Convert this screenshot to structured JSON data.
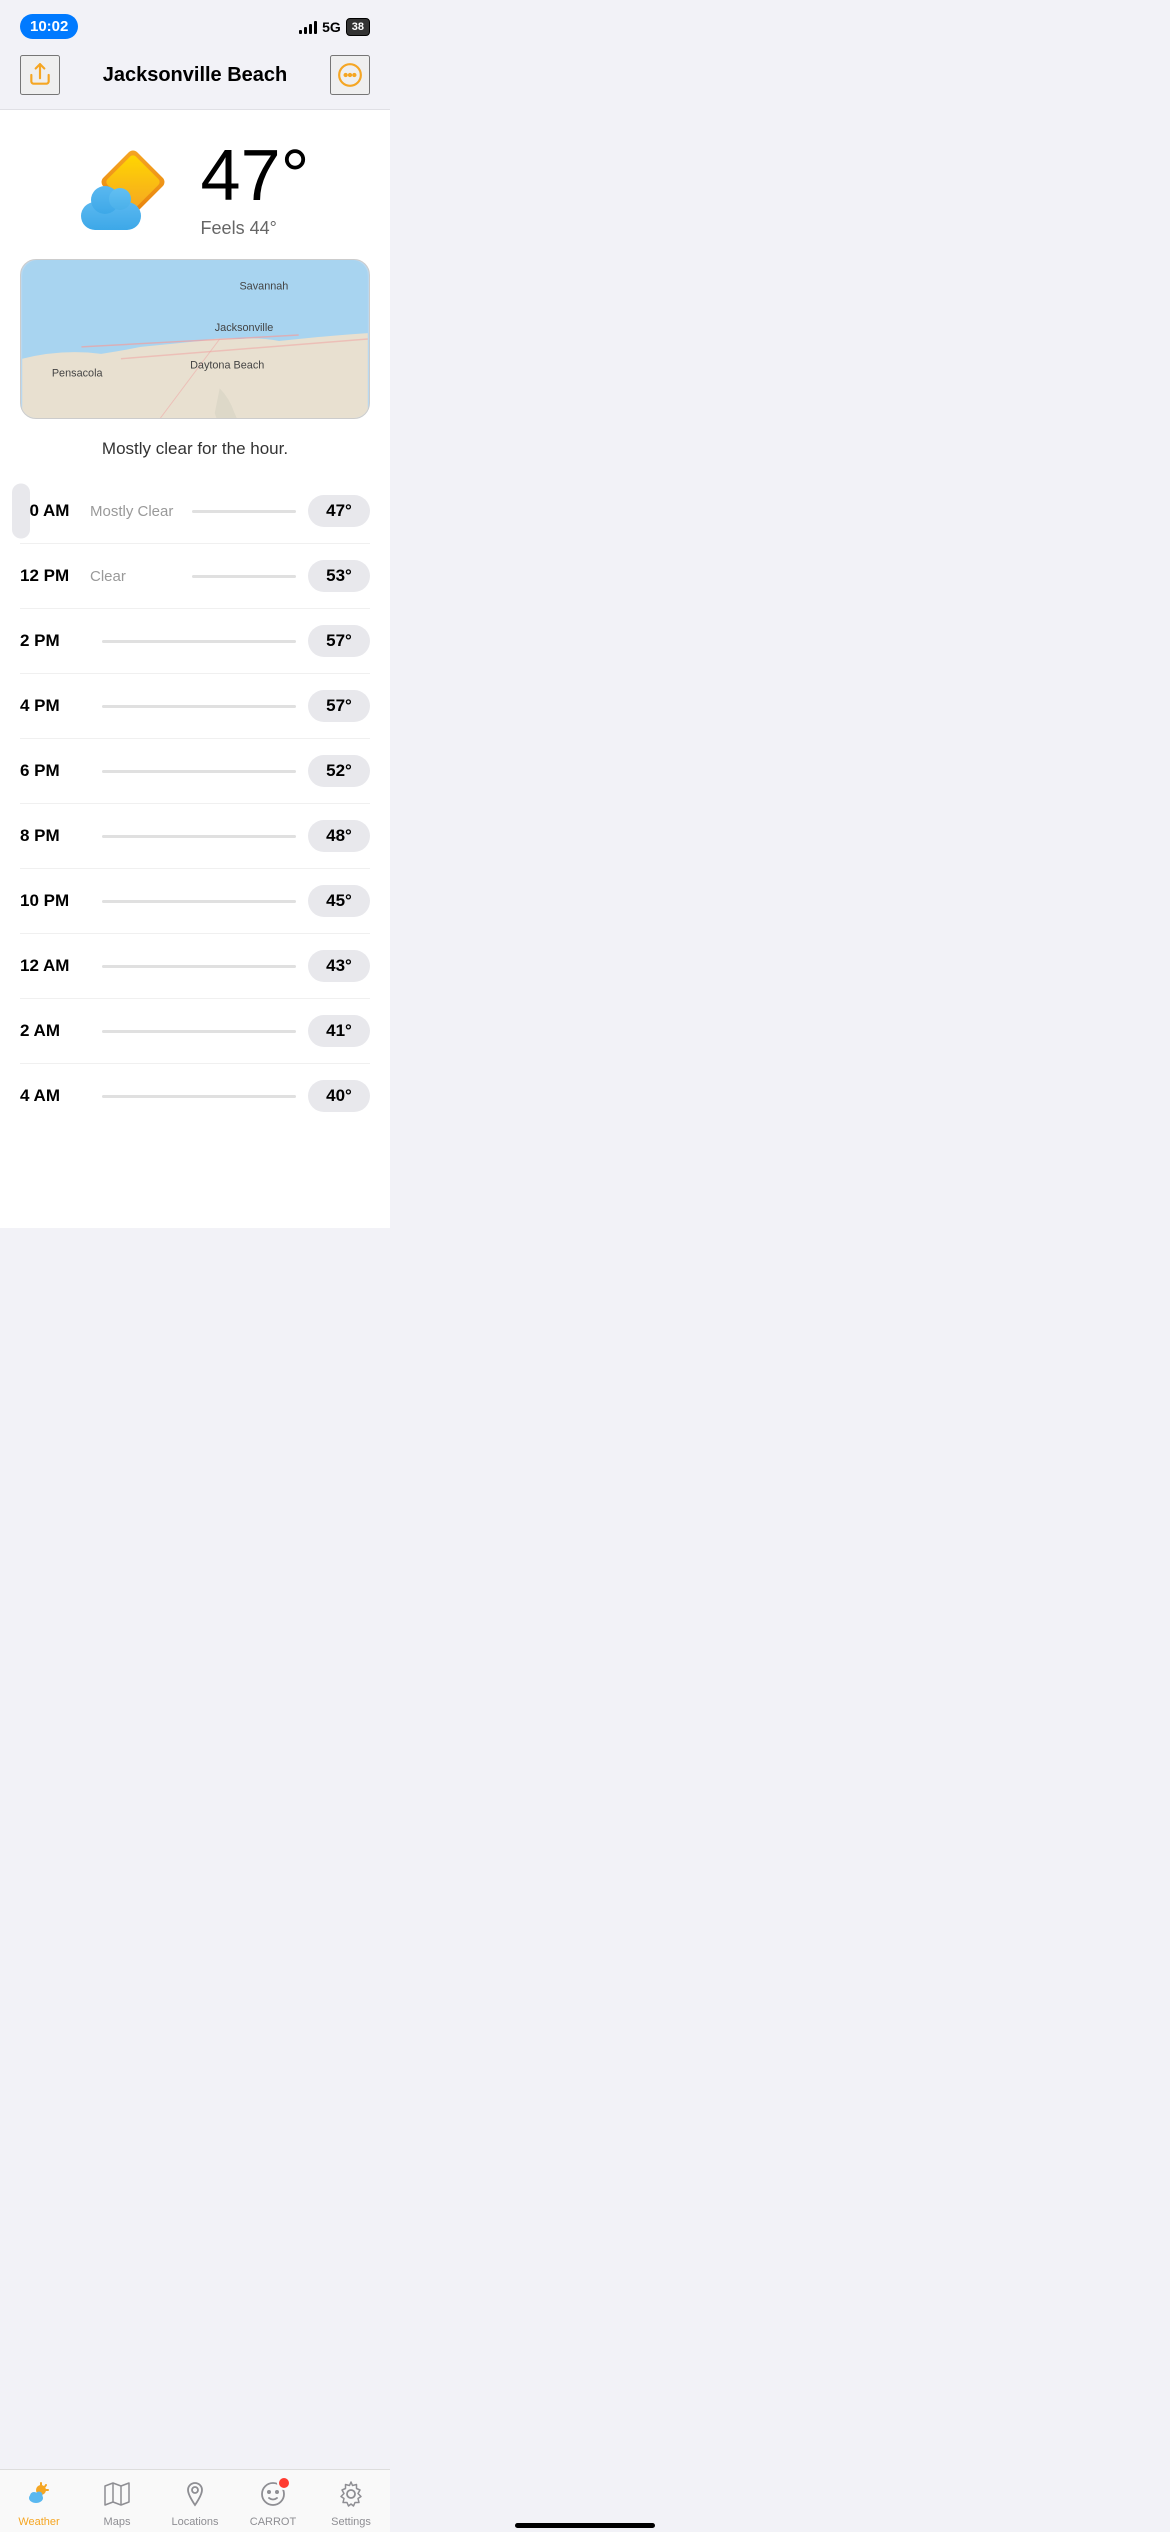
{
  "statusBar": {
    "time": "10:02",
    "network": "5G",
    "battery": "38"
  },
  "header": {
    "title": "Jacksonville Beach",
    "shareLabel": "share",
    "moreLabel": "more"
  },
  "weather": {
    "temperature": "47°",
    "feelsLike": "Feels 44°",
    "summary": "Mostly clear for the hour."
  },
  "hourlyForecast": [
    {
      "time": "10 AM",
      "condition": "Mostly Clear",
      "temp": "47°",
      "isCurrent": true
    },
    {
      "time": "12 PM",
      "condition": "Clear",
      "temp": "53°",
      "isCurrent": false
    },
    {
      "time": "2 PM",
      "condition": "",
      "temp": "57°",
      "isCurrent": false
    },
    {
      "time": "4 PM",
      "condition": "",
      "temp": "57°",
      "isCurrent": false
    },
    {
      "time": "6 PM",
      "condition": "",
      "temp": "52°",
      "isCurrent": false
    },
    {
      "time": "8 PM",
      "condition": "",
      "temp": "48°",
      "isCurrent": false
    },
    {
      "time": "10 PM",
      "condition": "",
      "temp": "45°",
      "isCurrent": false
    },
    {
      "time": "12 AM",
      "condition": "",
      "temp": "43°",
      "isCurrent": false
    },
    {
      "time": "2 AM",
      "condition": "",
      "temp": "41°",
      "isCurrent": false
    },
    {
      "time": "4 AM",
      "condition": "",
      "temp": "40°",
      "isCurrent": false
    }
  ],
  "mapLabels": {
    "savannah": "Savannah",
    "pensacola": "Pensacola",
    "jacksonville": "Jacksonville",
    "daytonaBeach": "Daytona Beach"
  },
  "tabBar": {
    "tabs": [
      {
        "id": "weather",
        "label": "Weather",
        "active": true
      },
      {
        "id": "maps",
        "label": "Maps",
        "active": false
      },
      {
        "id": "locations",
        "label": "Locations",
        "active": false
      },
      {
        "id": "carrot",
        "label": "CARROT",
        "active": false
      },
      {
        "id": "settings",
        "label": "Settings",
        "active": false
      }
    ]
  }
}
